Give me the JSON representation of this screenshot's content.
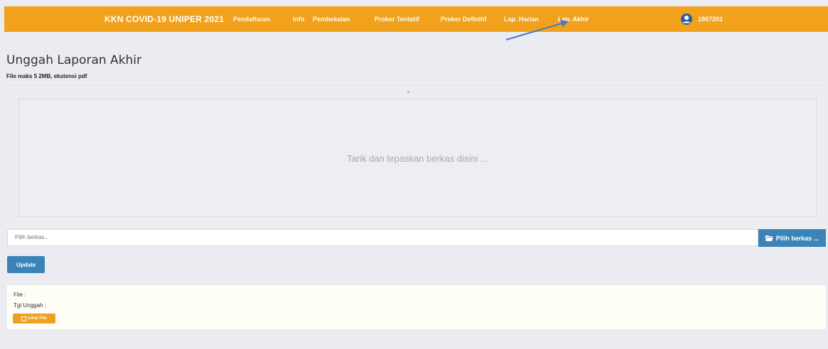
{
  "navbar": {
    "brand": "KKN COVID-19 UNIPER 2021",
    "items": [
      "Pendaftaran",
      "Info",
      "Pembekalan",
      "Proker Tentatif",
      "Proker Definitif",
      "Lap. Harian",
      "Lap. Akhir"
    ],
    "active_item": "Lap. Akhir",
    "user_label": "1907201",
    "accent": "#f2a11c"
  },
  "page": {
    "title": "Unggah Laporan Akhir",
    "hint": "File maks 5 2MB, ekstensi pdf"
  },
  "dropzone": {
    "close_glyph": "×",
    "text": "Tarik dan lepaskan berkas disini ..."
  },
  "file_input": {
    "placeholder": "Pilih berkas...",
    "browse_label": "Pilih berkas ...",
    "browse_icon": "folder-open-icon"
  },
  "update_label": "Update",
  "info": {
    "file_label": "File :",
    "date_label": "Tgl Unggah :",
    "view_label": "Lihat File"
  },
  "colors": {
    "primary": "#3a84b8",
    "warning": "#f0a020"
  }
}
